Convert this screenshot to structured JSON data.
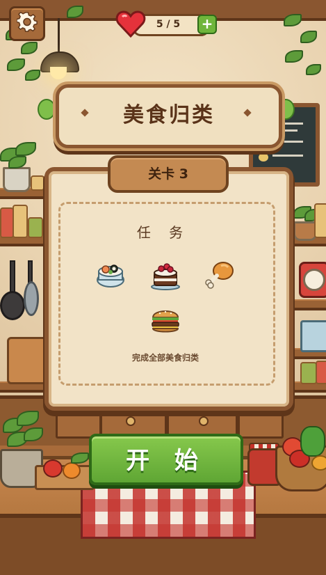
{
  "game": {
    "title": "美食归类",
    "lives": {
      "text": "5 / 5",
      "current": 5,
      "max": 5
    },
    "add_lives_label": "+",
    "level": {
      "label": "关卡 3"
    },
    "task": {
      "title": "任 务",
      "description": "完成全部美食归类",
      "foods": [
        "sushi-bowl-icon",
        "cake-icon",
        "chicken-leg-icon",
        "burger-icon"
      ]
    },
    "start_label": "开 始",
    "icons": {
      "settings": "gear-icon",
      "lives": "heart-icon"
    },
    "colors": {
      "accent_green": "#6fb53b",
      "wood": "#8a5630",
      "heart": "#e5323b"
    }
  }
}
